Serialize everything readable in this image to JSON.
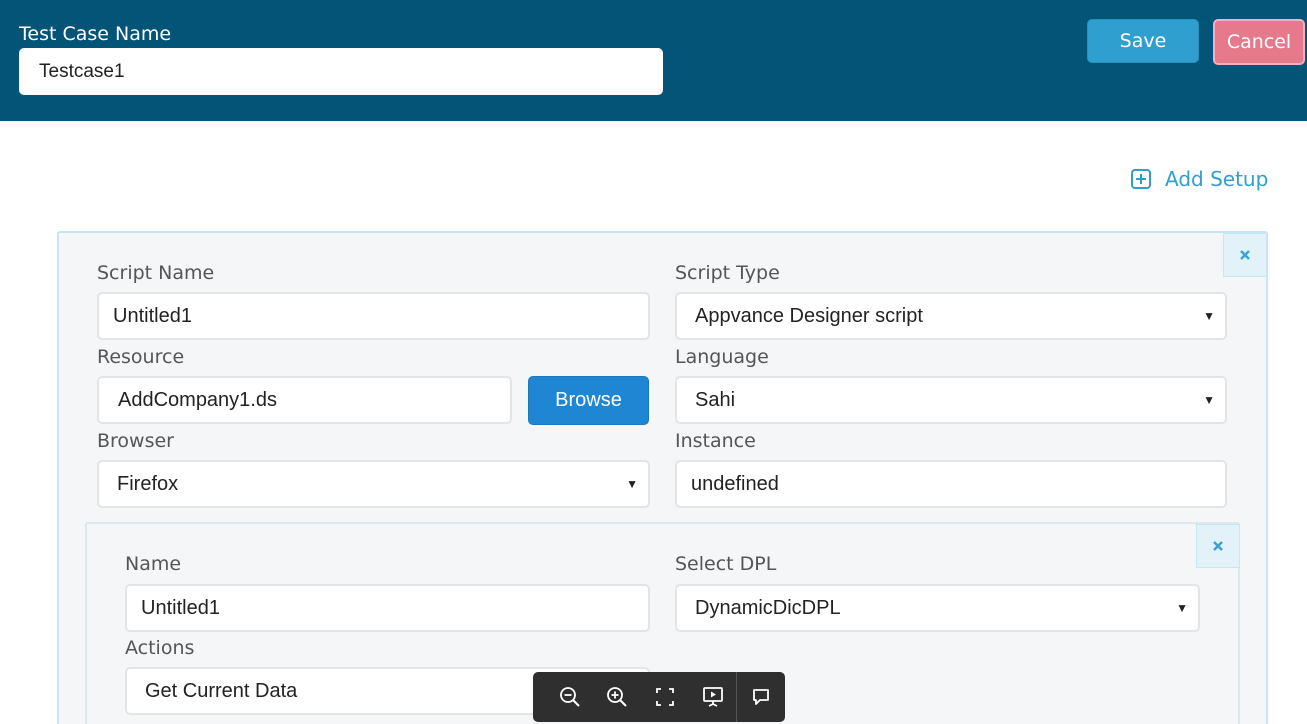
{
  "header": {
    "test_case_label": "Test Case Name",
    "test_case_value": "Testcase1",
    "save_label": "Save",
    "cancel_label": "Cancel"
  },
  "add_setup": {
    "label": "Add Setup",
    "icon": "plus-square-icon"
  },
  "script": {
    "script_name_label": "Script Name",
    "script_name_value": "Untitled1",
    "script_type_label": "Script Type",
    "script_type_value": "Appvance Designer script",
    "resource_label": "Resource",
    "resource_value": "AddCompany1.ds",
    "browse_label": "Browse",
    "language_label": "Language",
    "language_value": "Sahi",
    "browser_label": "Browser",
    "browser_value": "Firefox",
    "instance_label": "Instance",
    "instance_value": "undefined"
  },
  "dpl": {
    "name_label": "Name",
    "name_value": "Untitled1",
    "select_dpl_label": "Select DPL",
    "select_dpl_value": "DynamicDicDPL",
    "actions_label": "Actions",
    "actions_value": "Get Current Data"
  },
  "toolbar": {
    "icons": [
      "zoom-out-icon",
      "zoom-in-icon",
      "fullscreen-icon",
      "present-icon",
      "comment-icon"
    ]
  },
  "colors": {
    "header_bg": "#035477",
    "accent": "#2f9fcf",
    "cancel": "#e7798d",
    "browse": "#1f86d4"
  }
}
